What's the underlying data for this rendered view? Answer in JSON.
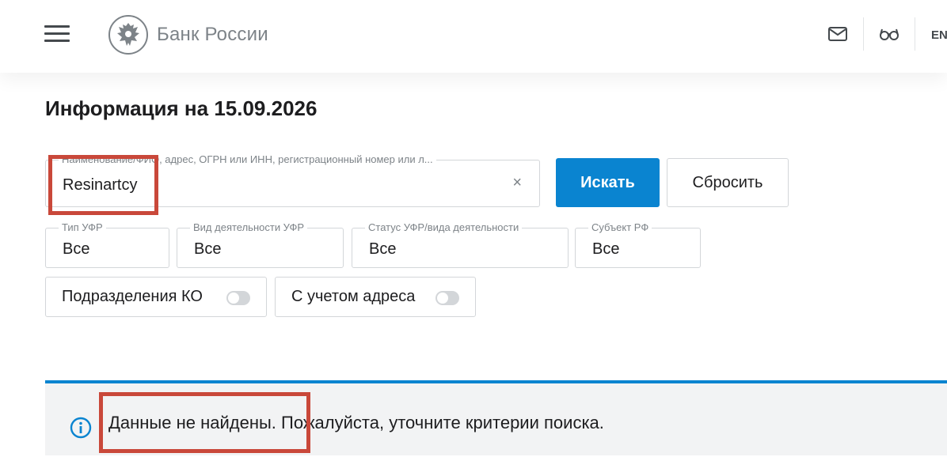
{
  "header": {
    "logo_text": "Банк России",
    "lang": "EN",
    "icons": [
      "menu-icon",
      "emblem-icon",
      "mail-icon",
      "glasses-icon"
    ]
  },
  "page": {
    "title": "Информация на 15.09.2026"
  },
  "search": {
    "label": "Наименование/ФИО, адрес, ОГРН или ИНН, регистрационный номер или л...",
    "value": "Resinartcy",
    "clear_symbol": "×",
    "search_button": "Искать",
    "reset_button": "Сбросить"
  },
  "filters": [
    {
      "label": "Тип УФР",
      "value": "Все"
    },
    {
      "label": "Вид деятельности УФР",
      "value": "Все"
    },
    {
      "label": "Статус УФР/вида деятельности",
      "value": "Все"
    },
    {
      "label": "Субъект РФ",
      "value": "Все"
    }
  ],
  "toggles": [
    {
      "label": "Подразделения КО",
      "on": false
    },
    {
      "label": "С учетом адреса",
      "on": false
    }
  ],
  "message": {
    "highlighted": "Данные не найдены.",
    "rest": " Пожалуйста, уточните критерии поиска."
  },
  "colors": {
    "accent": "#0a84d0",
    "highlight": "#c9483a",
    "info_bg": "#f2f3f4"
  }
}
